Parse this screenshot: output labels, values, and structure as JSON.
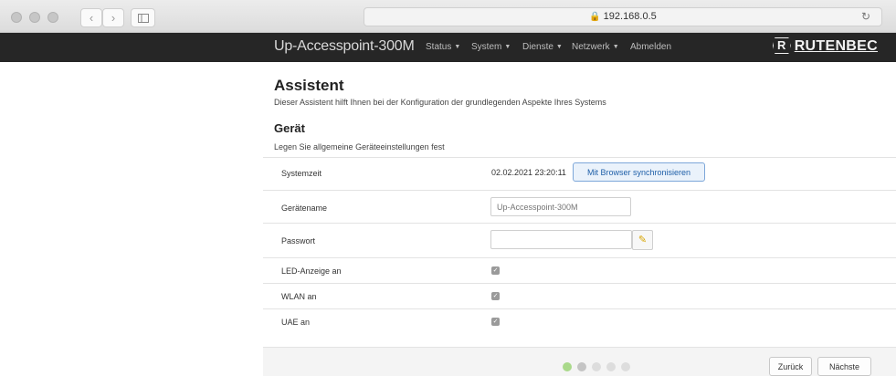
{
  "browser": {
    "url": "192.168.0.5",
    "lock_icon": "lock-icon",
    "reload_icon": "reload-icon",
    "back_label": "‹",
    "forward_label": "›"
  },
  "navbar": {
    "brand": "Up-Accesspoint-300M",
    "menus": [
      {
        "label": "Status",
        "has_dropdown": true
      },
      {
        "label": "System",
        "has_dropdown": true
      },
      {
        "label": "Dienste",
        "has_dropdown": true
      },
      {
        "label": "Netzwerk",
        "has_dropdown": true
      },
      {
        "label": "Abmelden",
        "has_dropdown": false
      }
    ],
    "logo_mark": "R",
    "logo_text": "RUTENBEC"
  },
  "page": {
    "title": "Assistent",
    "subtitle": "Dieser Assistent hilft Ihnen bei der Konfiguration der grundlegenden Aspekte Ihres Systems",
    "section_title": "Gerät",
    "section_subtitle": "Legen Sie allgemeine Geräteeinstellungen fest"
  },
  "form": {
    "system_time": {
      "label": "Systemzeit",
      "value": "02.02.2021 23:20:11",
      "sync_button": "Mit Browser synchronisieren"
    },
    "device_name": {
      "label": "Gerätename",
      "value": "",
      "placeholder": "Up-Accesspoint-300M"
    },
    "password": {
      "label": "Passwort",
      "value": "",
      "icon": "key-icon"
    },
    "led": {
      "label": "LED-Anzeige an",
      "checked": true
    },
    "wlan": {
      "label": "WLAN an",
      "checked": true
    },
    "uae": {
      "label": "UAE an",
      "checked": true
    }
  },
  "footer": {
    "steps_total": 5,
    "steps_active": 2,
    "back_button": "Zurück",
    "next_button": "Nächste"
  },
  "colors": {
    "navbar_bg": "#262626",
    "accent_blue": "#7da7d9",
    "step_active": "#a9d98a",
    "step_current": "#c4c4c4",
    "step_inactive": "#dddddd"
  }
}
